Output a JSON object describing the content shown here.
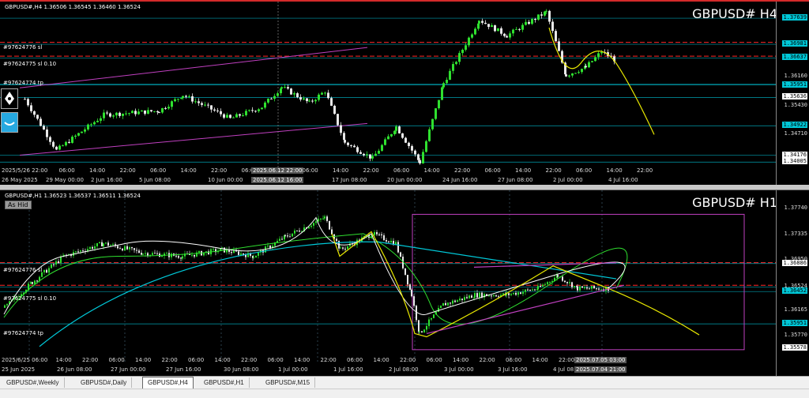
{
  "colors": {
    "bull": "#2fe02f",
    "bear": "#e8e8e8",
    "cyan": "#00c8d8",
    "red": "#ff2a2a",
    "magenta": "#c040c0",
    "yellow": "#e8e800",
    "white": "#ffffff",
    "grid": "#00a0b0"
  },
  "h4": {
    "info": "GBPUSD#,H4  1.36506 1.36545 1.36460 1.36524",
    "symbol": "GBPUSD# H4",
    "price_labels": [
      {
        "text": "1.37639",
        "y": 1.37639,
        "style": "hl"
      },
      {
        "text": "1.36981",
        "y": 1.36981,
        "style": "hl"
      },
      {
        "text": "1.36637",
        "y": 1.36637,
        "style": "hl"
      },
      {
        "text": "1.36160",
        "y": 1.3616,
        "style": ""
      },
      {
        "text": "1.35951",
        "y": 1.35951,
        "style": "hl"
      },
      {
        "text": "1.35636",
        "y": 1.35636,
        "style": "wh"
      },
      {
        "text": "1.35430",
        "y": 1.3543,
        "style": ""
      },
      {
        "text": "1.34922",
        "y": 1.34922,
        "style": "hl"
      },
      {
        "text": "1.34710",
        "y": 1.3471,
        "style": ""
      },
      {
        "text": "1.34176",
        "y": 1.34176,
        "style": "wh"
      },
      {
        "text": "1.34005",
        "y": 1.34005,
        "style": "wh"
      }
    ],
    "time_labels": [
      "26 May 2025",
      "29 May 00:00",
      "2 Jun 16:00",
      "5 Jun 08:00",
      "10 Jun 00:00",
      "2025.06.12 16:00",
      "17 Jun 08:00",
      "20 Jun 00:00",
      "24 Jun 16:00",
      "27 Jun 08:00",
      "2 Jul 00:00",
      "4 Jul 16:00"
    ],
    "hour_labels": [
      "2025/5/26 22:00",
      "06:00",
      "14:00",
      "22:00",
      "06:00",
      "14:00",
      "22:00",
      "06:00",
      "2025.06.12 22:00",
      "06:00",
      "14:00",
      "22:00",
      "06:00",
      "14:00",
      "22:00",
      "06:00",
      "14:00",
      "22:00",
      "06:00",
      "14:00",
      "22:00"
    ],
    "order_labels": [
      "#97624776 sl",
      "#97624775 sl 0.10",
      "#97624774 tp"
    ],
    "crosshair_time": "2025.06.12 22:00"
  },
  "h1": {
    "info": "GBPUSD#,H1  1.36523 1.36537 1.36511 1.36524",
    "symbol": "GBPUSD# H1",
    "as_hide": "As Hid",
    "price_labels": [
      {
        "text": "1.37740",
        "y": 1.3774,
        "style": ""
      },
      {
        "text": "1.37335",
        "y": 1.37335,
        "style": ""
      },
      {
        "text": "1.36950",
        "y": 1.3695,
        "style": ""
      },
      {
        "text": "1.36886",
        "y": 1.36886,
        "style": "wh"
      },
      {
        "text": "1.36524",
        "y": 1.36524,
        "style": ""
      },
      {
        "text": "1.36452",
        "y": 1.36452,
        "style": "hl"
      },
      {
        "text": "1.36165",
        "y": 1.36165,
        "style": ""
      },
      {
        "text": "1.35951",
        "y": 1.35951,
        "style": "hl"
      },
      {
        "text": "1.35770",
        "y": 1.3577,
        "style": ""
      },
      {
        "text": "1.35578",
        "y": 1.35578,
        "style": "wh"
      }
    ],
    "time_labels": [
      "25 Jun 2025",
      "26 Jun 08:00",
      "27 Jun 00:00",
      "27 Jun 16:00",
      "30 Jun 08:00",
      "1 Jul 00:00",
      "1 Jul 16:00",
      "2 Jul 08:00",
      "3 Jul 00:00",
      "3 Jul 16:00",
      "4 Jul 08:00",
      "2025.07.04 21:00"
    ],
    "hour_labels": [
      "2025/6/25 06:00",
      "14:00",
      "22:00",
      "06:00",
      "14:00",
      "22:00",
      "06:00",
      "14:00",
      "22:00",
      "06:00",
      "14:00",
      "22:00",
      "06:00",
      "14:00",
      "22:00",
      "06:00",
      "14:00",
      "22:00",
      "06:00",
      "14:00",
      "22:00",
      "2025.07.05 03:00"
    ],
    "order_labels": [
      "#97624776 sl",
      "#97624775 sl 0.10",
      "#97624774 tp"
    ]
  },
  "tabs": [
    {
      "label": "GBPUSD#,Weekly",
      "active": false
    },
    {
      "label": "GBPUSD#,Daily",
      "active": false
    },
    {
      "label": "GBPUSD#,H4",
      "active": true
    },
    {
      "label": "GBPUSD#,H1",
      "active": false
    },
    {
      "label": "GBPUSD#,M15",
      "active": false
    }
  ]
}
